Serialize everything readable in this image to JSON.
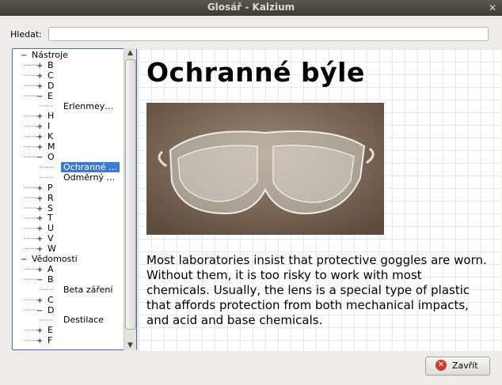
{
  "window": {
    "title": "Glosář - Kalzium"
  },
  "search": {
    "label": "Hledat:",
    "value": ""
  },
  "tree": [
    {
      "label": "Nástroje",
      "level": 0,
      "expander": "−"
    },
    {
      "label": "B",
      "level": 1,
      "expander": "+"
    },
    {
      "label": "C",
      "level": 1,
      "expander": "+"
    },
    {
      "label": "D",
      "level": 1,
      "expander": "+"
    },
    {
      "label": "E",
      "level": 1,
      "expander": "−"
    },
    {
      "label": "Erlenmey…",
      "level": 2,
      "expander": ""
    },
    {
      "label": "H",
      "level": 1,
      "expander": "+"
    },
    {
      "label": "I",
      "level": 1,
      "expander": "+"
    },
    {
      "label": "K",
      "level": 1,
      "expander": "+"
    },
    {
      "label": "M",
      "level": 1,
      "expander": "+"
    },
    {
      "label": "O",
      "level": 1,
      "expander": "−"
    },
    {
      "label": "Ochranné …",
      "level": 2,
      "expander": "",
      "selected": true
    },
    {
      "label": "Odměrný …",
      "level": 2,
      "expander": ""
    },
    {
      "label": "P",
      "level": 1,
      "expander": "+"
    },
    {
      "label": "R",
      "level": 1,
      "expander": "+"
    },
    {
      "label": "S",
      "level": 1,
      "expander": "+"
    },
    {
      "label": "T",
      "level": 1,
      "expander": "+"
    },
    {
      "label": "U",
      "level": 1,
      "expander": "+"
    },
    {
      "label": "V",
      "level": 1,
      "expander": "+"
    },
    {
      "label": "W",
      "level": 1,
      "expander": "+"
    },
    {
      "label": "Vědomosti",
      "level": 0,
      "expander": "−"
    },
    {
      "label": "A",
      "level": 1,
      "expander": "+"
    },
    {
      "label": "B",
      "level": 1,
      "expander": "−"
    },
    {
      "label": "Beta záření",
      "level": 2,
      "expander": ""
    },
    {
      "label": "C",
      "level": 1,
      "expander": "+"
    },
    {
      "label": "D",
      "level": 1,
      "expander": "−"
    },
    {
      "label": "Destilace",
      "level": 2,
      "expander": ""
    },
    {
      "label": "E",
      "level": 1,
      "expander": "+"
    },
    {
      "label": "F",
      "level": 1,
      "expander": "+"
    }
  ],
  "article": {
    "title": "Ochranné býle",
    "text": "Most laboratories insist that protective goggles are worn. Without them, it is too risky to work with most chemicals. Usually, the lens is a special type of plastic that affords protection from both mechanical impacts, and acid and base chemicals."
  },
  "buttons": {
    "close_label": "Zavřít"
  },
  "colors": {
    "selection": "#3d7ad1",
    "close_icon": "#d23a2e"
  }
}
